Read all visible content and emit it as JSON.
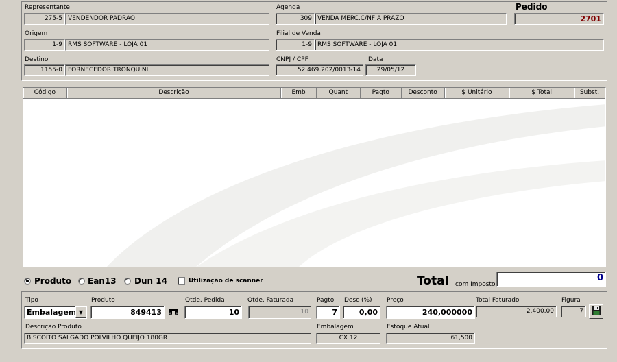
{
  "header": {
    "representante": {
      "label": "Representante",
      "code": "275-5",
      "name": "VENDENDOR PADRAO"
    },
    "agenda": {
      "label": "Agenda",
      "code": "309",
      "name": "VENDA MERC.C/NF A PRAZO"
    },
    "pedido": {
      "label": "Pedido",
      "value": "2701"
    },
    "origem": {
      "label": "Origem",
      "code": "1-9",
      "name": "RMS SOFTWARE - LOJA 01"
    },
    "filial": {
      "label": "Filial de Venda",
      "code": "1-9",
      "name": "RMS SOFTWARE - LOJA 01"
    },
    "destino": {
      "label": "Destino",
      "code": "1155-0",
      "name": "FORNECEDOR TRONQUINI"
    },
    "cnpj": {
      "label": "CNPJ / CPF",
      "value": "52.469.202/0013-14"
    },
    "data": {
      "label": "Data",
      "value": "29/05/12"
    }
  },
  "grid": {
    "columns": [
      "Código",
      "Descrição",
      "Emb",
      "Quant",
      "Pagto",
      "Desconto",
      "$ Unitário",
      "$ Total",
      "Subst."
    ]
  },
  "options": {
    "produto": "Produto",
    "ean13": "Ean13",
    "dun14": "Dun 14",
    "scanner": "Utilização de scanner",
    "selected": "Produto"
  },
  "total": {
    "label": "Total",
    "sublabel": "com Impostos",
    "value": "0"
  },
  "entry": {
    "tipo": {
      "label": "Tipo",
      "value": "Embalagem"
    },
    "produto": {
      "label": "Produto",
      "value": "849413"
    },
    "qtde_pedida": {
      "label": "Qtde. Pedida",
      "value": "10"
    },
    "qtde_faturada": {
      "label": "Qtde. Faturada",
      "value": "10"
    },
    "pagto": {
      "label": "Pagto",
      "value": "7"
    },
    "desc": {
      "label": "Desc (%)",
      "value": "0,00"
    },
    "preco": {
      "label": "Preço",
      "value": "240,000000"
    },
    "total_faturado": {
      "label": "Total Faturado",
      "value": "2.400,00"
    },
    "figura": {
      "label": "Figura",
      "value": "7"
    },
    "descricao": {
      "label": "Descrição Produto",
      "value": "BISCOITO SALGADO POLVILHO QUEIJO 180GR"
    },
    "embalagem": {
      "label": "Embalagem",
      "value": "CX  12"
    },
    "estoque": {
      "label": "Estoque Atual",
      "value": "61,500"
    }
  },
  "colors": {
    "pedido_value": "#800000",
    "background": "#d4d0c8"
  }
}
